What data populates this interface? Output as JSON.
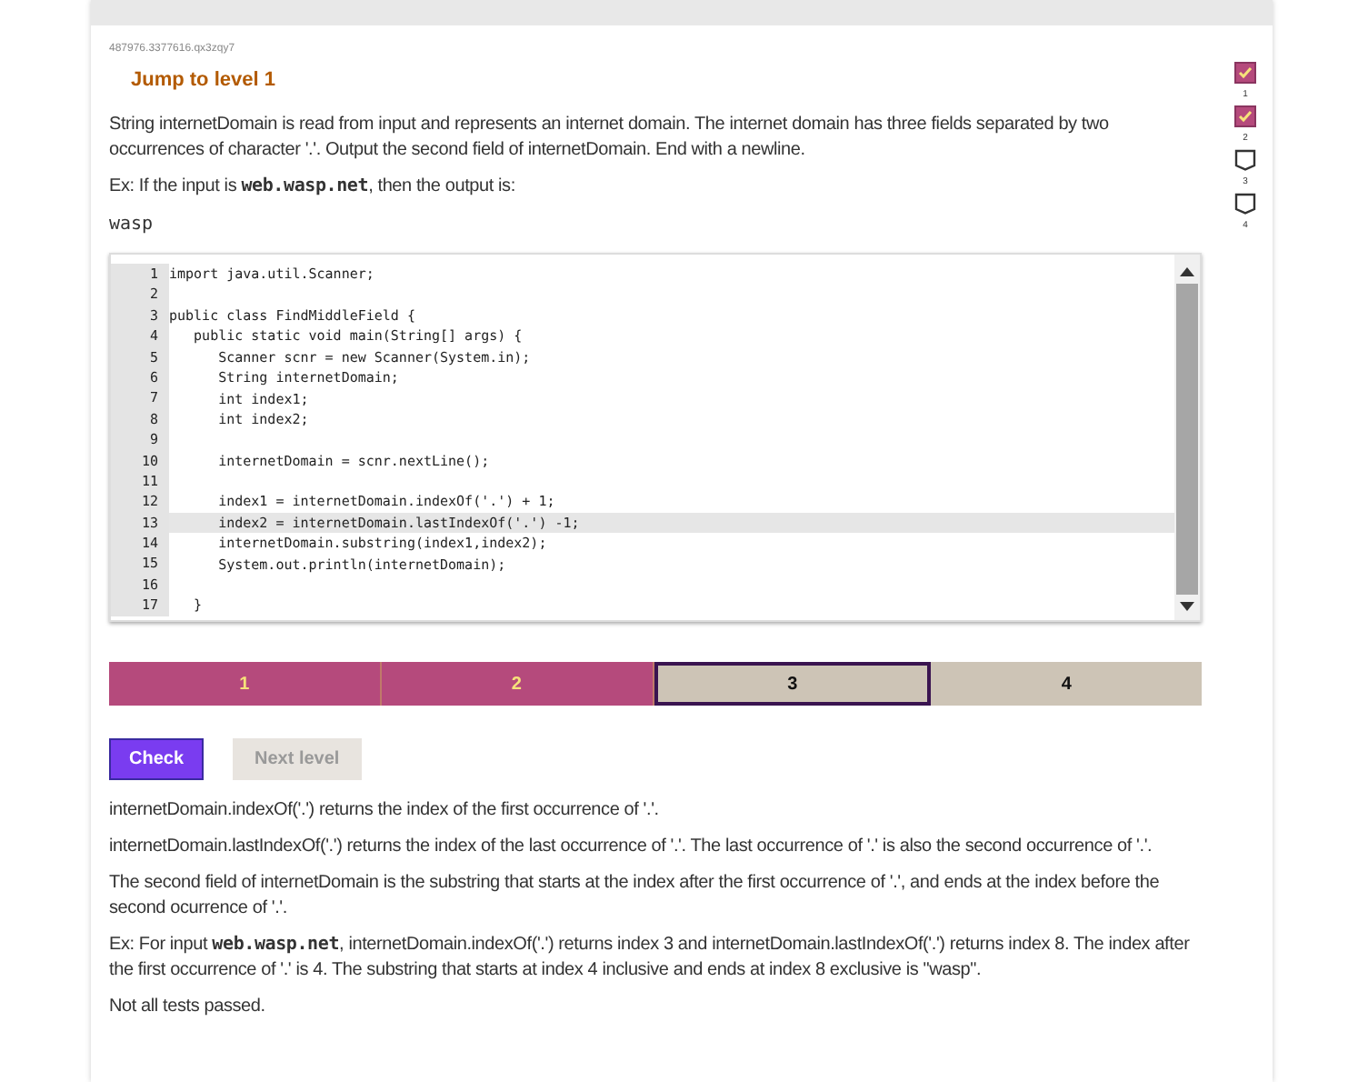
{
  "activity_id": "487976.3377616.qx3zqy7",
  "title": "Jump to level 1",
  "prompt": "String internetDomain is read from input and represents an internet domain. The internet domain has three fields separated by two occurrences of character '.'. Output the second field of internetDomain. End with a newline.",
  "example": {
    "before": "Ex: If the input is",
    "code": "web.wasp.net",
    "after": ", then the output is:"
  },
  "example_output": "wasp",
  "level_checks": [
    {
      "label": "1",
      "checked": true
    },
    {
      "label": "2",
      "checked": true
    },
    {
      "label": "3",
      "checked": false
    },
    {
      "label": "4",
      "checked": false
    }
  ],
  "code_lines": [
    {
      "number": "1",
      "text": "import java.util.Scanner;",
      "highlighted": false
    },
    {
      "number": "2",
      "highlighted": false
    },
    {
      "number": "3",
      "text": "public class FindMiddleField {",
      "highlighted": false
    },
    {
      "number": "4",
      "text": "   public static void main(String[] args) {",
      "highlighted": false
    },
    {
      "number": "5",
      "text": "      Scanner scnr = new Scanner(System.in);",
      "highlighted": false
    },
    {
      "number": "6",
      "text": "      String internetDomain;",
      "highlighted": false
    },
    {
      "number": "7",
      "text": "      int index1;",
      "highlighted": false
    },
    {
      "number": "8",
      "text": "      int index2;",
      "highlighted": false
    },
    {
      "number": "9",
      "highlighted": false
    },
    {
      "number": "10",
      "text": "      internetDomain = scnr.nextLine();",
      "highlighted": false
    },
    {
      "number": "11",
      "highlighted": false
    },
    {
      "number": "12",
      "text": "      index1 = internetDomain.indexOf('.') + 1;",
      "highlighted": false
    },
    {
      "number": "13",
      "text": "      index2 = internetDomain.lastIndexOf('.') -1;",
      "highlighted": true
    },
    {
      "number": "14",
      "text": "      internetDomain.substring(index1,index2);",
      "highlighted": false
    },
    {
      "number": "15",
      "text": "      System.out.println(internetDomain);",
      "highlighted": false
    },
    {
      "number": "16",
      "highlighted": false
    },
    {
      "number": "17",
      "text": "   }",
      "highlighted": false
    }
  ],
  "levels": [
    {
      "label": "1",
      "completed": true,
      "selected": false
    },
    {
      "label": "2",
      "completed": true,
      "selected": false
    },
    {
      "label": "3",
      "completed": false,
      "selected": true
    },
    {
      "label": "4",
      "completed": false,
      "selected": false
    }
  ],
  "buttons": {
    "check": "Check",
    "next_level": "Next level",
    "next_disabled": true
  },
  "feedback": [
    "internetDomain.indexOf('.') returns the index of the first occurrence of '.'.",
    "internetDomain.lastIndexOf('.') returns the index of the last occurrence of '.'. The last occurrence of '.' is also the second occurrence of '.'.",
    "The second field of internetDomain is the substring that starts at the index after the first occurrence of '.', and ends at the index before the second ocurrence of '.'.",
    {
      "before": "Ex: For input",
      "code": "web.wasp.net",
      "after": ", internetDomain.indexOf('.') returns index 3 and internetDomain.lastIndexOf('.') returns index 8. The index after the first occurrence of '.' is 4. The substring that starts at index 4 inclusive and ends at index 8 exclusive is \"wasp\"."
    },
    "Not all tests passed."
  ]
}
